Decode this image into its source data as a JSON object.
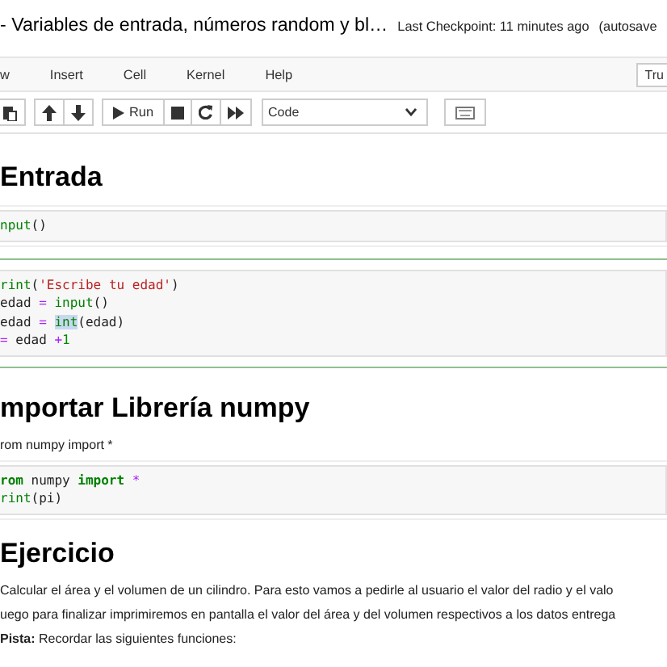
{
  "header": {
    "title": "- Variables de entrada, números random y bl…",
    "checkpoint": "Last Checkpoint: 11 minutes ago",
    "autosave": "(autosave"
  },
  "menu": {
    "items": [
      "w",
      "Insert",
      "Cell",
      "Kernel",
      "Help"
    ],
    "trusted": "Tru"
  },
  "toolbar": {
    "run": "Run",
    "cell_type": "Code"
  },
  "cells": [
    {
      "kind": "heading",
      "text": "Entrada"
    },
    {
      "kind": "code",
      "selected": false,
      "lines": [
        [
          {
            "text": "nput",
            "kind": "builtin"
          },
          {
            "text": "()",
            "kind": "plain"
          }
        ]
      ]
    },
    {
      "kind": "code",
      "selected": true,
      "lines": [
        [
          {
            "text": "rint",
            "kind": "builtin"
          },
          {
            "text": "(",
            "kind": "plain"
          },
          {
            "text": "'Escribe tu edad'",
            "kind": "string"
          },
          {
            "text": ")",
            "kind": "plain"
          }
        ],
        [
          {
            "text": "edad",
            "kind": "plain"
          },
          {
            "text": "=",
            "kind": "op",
            "space_before": true
          },
          {
            "text": "input",
            "kind": "builtin",
            "space_before": true
          },
          {
            "text": "()",
            "kind": "plain"
          }
        ],
        [
          {
            "text": "edad",
            "kind": "plain"
          },
          {
            "text": "=",
            "kind": "op",
            "space_before": true
          },
          {
            "text": "int",
            "kind": "highlight",
            "space_before": true
          },
          {
            "text": "(edad)",
            "kind": "plain"
          }
        ],
        [
          {
            "text": "=",
            "kind": "op"
          },
          {
            "text": "edad",
            "kind": "plain",
            "space_before": true
          },
          {
            "text": "+",
            "kind": "op",
            "space_before": true
          },
          {
            "text": "1",
            "kind": "number"
          }
        ]
      ]
    },
    {
      "kind": "heading",
      "text": "mportar Librería numpy"
    },
    {
      "kind": "text",
      "text": "rom numpy import *"
    },
    {
      "kind": "code",
      "selected": false,
      "lines": [
        [
          {
            "text": "rom",
            "kind": "keyword"
          },
          {
            "text": "numpy",
            "kind": "plain",
            "space_before": true
          },
          {
            "text": "import",
            "kind": "keyword",
            "space_before": true
          },
          {
            "text": "*",
            "kind": "op",
            "space_before": true
          }
        ],
        [
          {
            "text": "rint",
            "kind": "builtin"
          },
          {
            "text": "(pi)",
            "kind": "plain"
          }
        ]
      ]
    },
    {
      "kind": "heading",
      "text": "Ejercicio"
    },
    {
      "kind": "text",
      "text": "Calcular el área y el volumen de un cilindro. Para esto vamos a pedirle al usuario el valor del radio y el valo"
    },
    {
      "kind": "text",
      "text": "uego para finalizar imprimiremos en pantalla el valor del área y del volumen respectivos a los datos entrega"
    },
    {
      "kind": "text",
      "text": "**Pista:** Recordar las siguientes funciones:"
    }
  ]
}
